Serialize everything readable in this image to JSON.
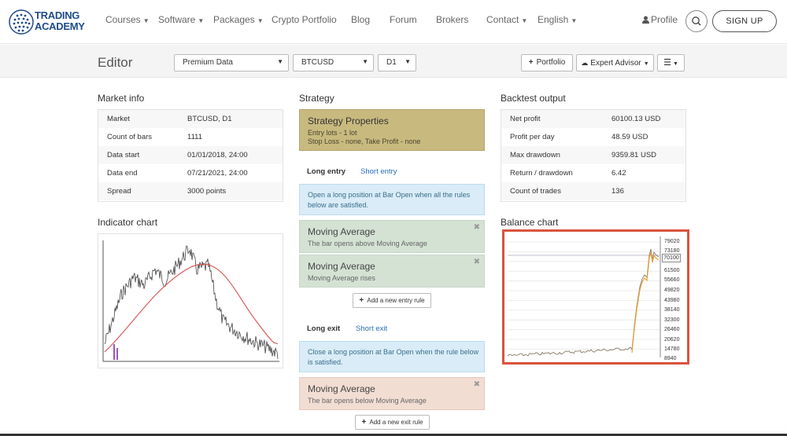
{
  "brand": {
    "line1": "TRADING",
    "line2": "ACADEMY"
  },
  "nav": {
    "items": [
      "Courses",
      "Software",
      "Packages",
      "Crypto Portfolio",
      "Blog",
      "Forum",
      "Brokers",
      "Contact",
      "English"
    ],
    "profile": "Profile",
    "signup": "SIGN UP"
  },
  "toolbar": {
    "title": "Editor",
    "data_source": "Premium Data",
    "symbol": "BTCUSD",
    "period": "D1",
    "portfolio": "Portfolio",
    "expert_advisor": "Expert Advisor"
  },
  "market_info": {
    "title": "Market info",
    "rows": [
      {
        "k": "Market",
        "v": "BTCUSD, D1"
      },
      {
        "k": "Count of bars",
        "v": "1111"
      },
      {
        "k": "Data start",
        "v": "01/01/2018, 24:00"
      },
      {
        "k": "Data end",
        "v": "07/21/2021, 24:00"
      },
      {
        "k": "Spread",
        "v": "3000 points"
      }
    ]
  },
  "strategy": {
    "title": "Strategy",
    "properties_title": "Strategy Properties",
    "entry_lots": "Entry lots - 1 lot",
    "sl_tp": "Stop Loss - none, Take Profit - none",
    "tab_long_entry": "Long entry",
    "tab_short_entry": "Short entry",
    "entry_info": "Open a long position at Bar Open when all the rules below are satisfied.",
    "entry_rules": [
      {
        "title": "Moving Average",
        "desc": "The bar opens above Moving Average"
      },
      {
        "title": "Moving Average",
        "desc": "Moving Average rises"
      }
    ],
    "add_entry": "Add a new entry rule",
    "tab_long_exit": "Long exit",
    "tab_short_exit": "Short exit",
    "exit_info": "Close a long position at Bar Open when the rule below is satisfied.",
    "exit_rule": {
      "title": "Moving Average",
      "desc": "The bar opens below Moving Average"
    },
    "add_exit": "Add a new exit rule"
  },
  "backtest": {
    "title": "Backtest output",
    "rows": [
      {
        "k": "Net profit",
        "v": "60100.13 USD"
      },
      {
        "k": "Profit per day",
        "v": "48.59 USD"
      },
      {
        "k": "Max drawdown",
        "v": "9359.81 USD"
      },
      {
        "k": "Return / drawdown",
        "v": "6.42"
      },
      {
        "k": "Count of trades",
        "v": "136"
      }
    ]
  },
  "indicator_chart": {
    "title": "Indicator chart"
  },
  "balance_chart": {
    "title": "Balance chart",
    "y_labels": [
      "79020",
      "73180",
      "61500",
      "55660",
      "49820",
      "43980",
      "38140",
      "32300",
      "26460",
      "20620",
      "14780",
      "8940"
    ],
    "current": "70100"
  },
  "colors": {
    "accent": "#2a6ebb",
    "highlight": "#d9533e",
    "ma_line": "#d9534f",
    "balance_line": "#e8a23c"
  }
}
